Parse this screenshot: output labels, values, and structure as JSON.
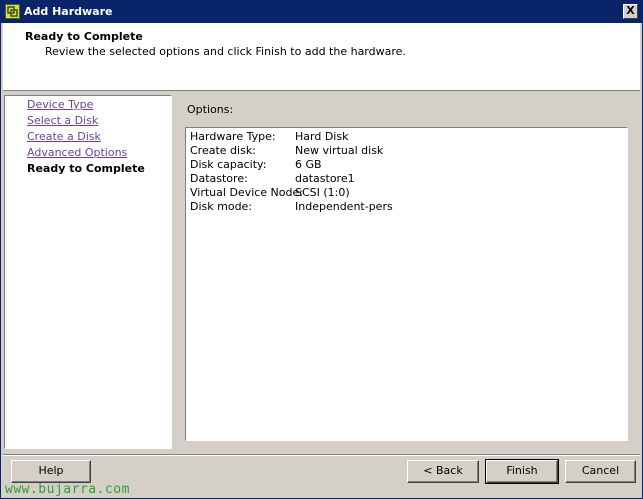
{
  "window": {
    "title": "Add Hardware",
    "close_label": "X"
  },
  "header": {
    "title": "Ready to Complete",
    "description": "Review the selected options and click Finish to add the hardware."
  },
  "sidebar": {
    "items": [
      {
        "label": "Device Type",
        "state": "link"
      },
      {
        "label": "Select a Disk",
        "state": "link"
      },
      {
        "label": "Create a Disk",
        "state": "link"
      },
      {
        "label": "Advanced Options",
        "state": "link"
      },
      {
        "label": "Ready to Complete",
        "state": "current"
      }
    ]
  },
  "main": {
    "options_label": "Options:",
    "options": [
      {
        "key": "Hardware Type:",
        "value": "Hard Disk"
      },
      {
        "key": "Create disk:",
        "value": "New virtual disk"
      },
      {
        "key": "Disk capacity:",
        "value": "6 GB"
      },
      {
        "key": "Datastore:",
        "value": "datastore1"
      },
      {
        "key": "Virtual Device Node:",
        "value": "SCSI (1:0)"
      },
      {
        "key": "Disk mode:",
        "value": "Independent-pers"
      }
    ]
  },
  "footer": {
    "help_label": "Help",
    "back_label": "< Back",
    "finish_label": "Finish",
    "cancel_label": "Cancel"
  },
  "watermark": "www.bujarra.com",
  "colors": {
    "titlebar": "#0a246a",
    "link": "#6e3fa0",
    "watermark": "#2fa02f",
    "dialog": "#d4d0c8"
  }
}
